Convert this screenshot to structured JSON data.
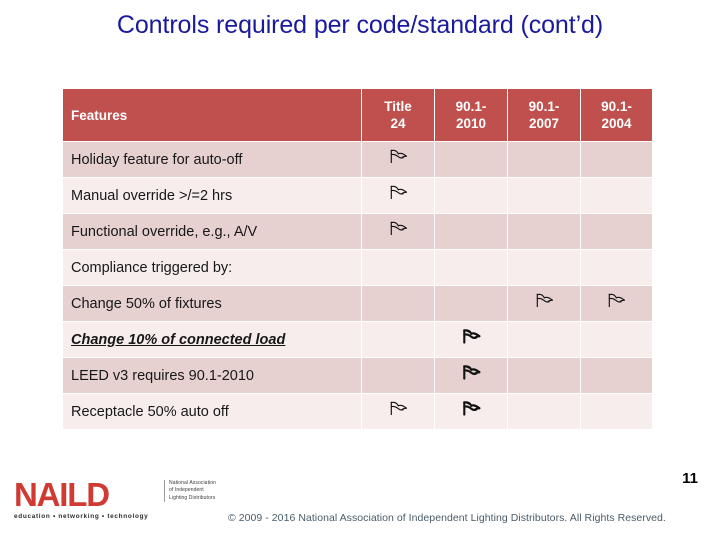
{
  "slide": {
    "title": "Controls required per code/standard (cont’d)",
    "page_number": "11",
    "title_color": "#1a1a9c"
  },
  "table": {
    "header_bg": "#c0504d",
    "row_dark_bg": "#e6d0d0",
    "row_light_bg": "#f6edec",
    "columns": [
      {
        "id": "feature",
        "label": "Features"
      },
      {
        "id": "title24",
        "label": "Title 24"
      },
      {
        "id": "std2010",
        "label": "90.1-2010"
      },
      {
        "id": "std2007",
        "label": "90.1-2007"
      },
      {
        "id": "std2004",
        "label": "90.1-2004"
      }
    ],
    "column_labels_wrapped": [
      {
        "line1": "Title",
        "line2": "24"
      },
      {
        "line1": "90.1-",
        "line2": "2010"
      },
      {
        "line1": "90.1-",
        "line2": "2007"
      },
      {
        "line1": "90.1-",
        "line2": "2004"
      }
    ],
    "mark_icon": "pointing-hand-icon",
    "rows": [
      {
        "feature": "Holiday feature for auto-off",
        "indent": 0,
        "style": "normal",
        "shade": "dark",
        "marks": {
          "title24": true,
          "std2010": false,
          "std2007": false,
          "std2004": false
        }
      },
      {
        "feature": "Manual override >/=2 hrs",
        "indent": 0,
        "style": "normal",
        "shade": "light",
        "marks": {
          "title24": true,
          "std2010": false,
          "std2007": false,
          "std2004": false
        }
      },
      {
        "feature": "Functional override, e.g., A/V",
        "indent": 0,
        "style": "normal",
        "shade": "dark",
        "marks": {
          "title24": true,
          "std2010": false,
          "std2007": false,
          "std2004": false
        }
      },
      {
        "feature": "Compliance triggered by:",
        "indent": 0,
        "style": "normal",
        "shade": "light",
        "marks": {
          "title24": false,
          "std2010": false,
          "std2007": false,
          "std2004": false
        }
      },
      {
        "feature": "Change 50% of fixtures",
        "indent": 1,
        "style": "normal",
        "shade": "dark",
        "marks": {
          "title24": false,
          "std2010": false,
          "std2007": true,
          "std2004": true
        }
      },
      {
        "feature": "Change 10% of connected load",
        "indent": 2,
        "style": "bold-italic-underline",
        "shade": "light",
        "marks": {
          "title24": false,
          "std2010": true,
          "std2007": false,
          "std2004": false
        }
      },
      {
        "feature": "LEED v3 requires 90.1-2010",
        "indent": 0,
        "style": "normal",
        "shade": "dark",
        "marks": {
          "title24": false,
          "std2010": true,
          "std2007": false,
          "std2004": false
        }
      },
      {
        "feature": "Receptacle 50% auto off",
        "indent": 0,
        "style": "normal",
        "shade": "light",
        "marks": {
          "title24": true,
          "std2010": true,
          "std2007": false,
          "std2004": false
        }
      }
    ]
  },
  "footer": {
    "logo_word": "NAILD",
    "logo_tagline": "education • networking • technology",
    "logo_side_text": "National Association of Independent Lighting Distributors",
    "logo_color": "#cf3a33",
    "copyright": "© 2009 - 2016 National Association of Independent Lighting Distributors. All Rights Reserved."
  }
}
